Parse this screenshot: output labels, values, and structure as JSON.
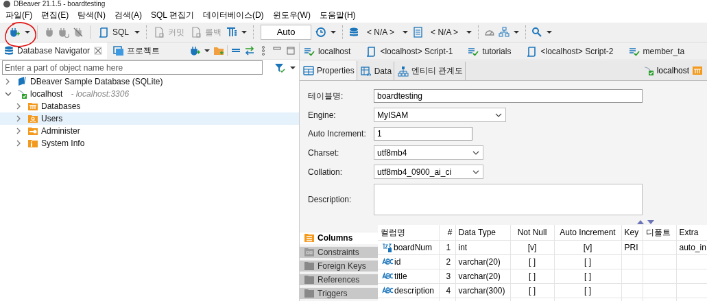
{
  "window": {
    "title": "DBeaver 21.1.5 - boardtesting"
  },
  "menu": [
    "파일(F)",
    "편집(E)",
    "탐색(N)",
    "검색(A)",
    "SQL 편집기",
    "데이터베이스(D)",
    "윈도우(W)",
    "도움말(H)"
  ],
  "toolbar": {
    "sql": "SQL",
    "commit": "커밋",
    "rollback": "롤백",
    "transaction_mode": "Auto",
    "datasource": "< N/A >",
    "schema": "< N/A >"
  },
  "navigator": {
    "tabs": [
      {
        "label": "Database Navigator",
        "selected": true
      },
      {
        "label": "프로젝트",
        "selected": false
      }
    ],
    "filter": {
      "placeholder": "Enter a part of object name here"
    },
    "tree": [
      {
        "label": "DBeaver Sample Database (SQLite)",
        "kind": "sqlite",
        "expanded": false,
        "selected": false
      },
      {
        "label": "localhost",
        "detail": "- localhost:3306",
        "kind": "mysql",
        "expanded": true,
        "selected": false,
        "children": [
          {
            "label": "Databases",
            "kind": "databases",
            "expanded": false,
            "selected": false
          },
          {
            "label": "Users",
            "kind": "users",
            "expanded": false,
            "selected": true
          },
          {
            "label": "Administer",
            "kind": "administer",
            "expanded": false,
            "selected": false
          },
          {
            "label": "System Info",
            "kind": "info",
            "expanded": false,
            "selected": false
          }
        ]
      }
    ]
  },
  "editor_tabs": [
    {
      "label": "localhost",
      "kind": "console",
      "selected": false
    },
    {
      "label": "<localhost> Script-1",
      "kind": "script",
      "selected": false
    },
    {
      "label": "tutorials",
      "kind": "console",
      "selected": false
    },
    {
      "label": "<localhost> Script-2",
      "kind": "script",
      "selected": false
    },
    {
      "label": "member_ta",
      "kind": "console",
      "selected": false
    }
  ],
  "sub_tabs": [
    {
      "label": "Properties",
      "kind": "properties",
      "selected": true
    },
    {
      "label": "Data",
      "kind": "data",
      "selected": false
    },
    {
      "label": "엔티티 관계도",
      "kind": "diagram",
      "selected": false
    }
  ],
  "connection": "localhost",
  "properties": [
    {
      "label": "테이블명:",
      "kind": "text",
      "value": "boardtesting"
    },
    {
      "label": "Engine:",
      "kind": "select",
      "value": "MyISAM"
    },
    {
      "label": "Auto Increment:",
      "kind": "short",
      "value": "1"
    },
    {
      "label": "Charset:",
      "kind": "select-small",
      "value": "utf8mb4"
    },
    {
      "label": "Collation:",
      "kind": "select-small",
      "value": "utf8mb4_0900_ai_ci"
    },
    {
      "label": "Description:",
      "kind": "textarea"
    }
  ],
  "side_tabs": [
    {
      "label": "Columns",
      "selected": true
    },
    {
      "label": "Constraints",
      "selected": false
    },
    {
      "label": "Foreign Keys",
      "selected": false
    },
    {
      "label": "References",
      "selected": false
    },
    {
      "label": "Triggers",
      "selected": false
    }
  ],
  "columns_table": {
    "columns": [
      "컬럼명",
      "#",
      "Data Type",
      "Not Null",
      "Auto Increment",
      "Key",
      "디폴트",
      "Extra"
    ],
    "rows": [
      {
        "kind": "number",
        "name": "boardNum",
        "index": "1",
        "data_type": "int",
        "not_null": "[v]",
        "auto_increment": "[v]",
        "key": "PRI",
        "extra": "auto_in"
      },
      {
        "kind": "string",
        "name": "id",
        "index": "2",
        "data_type": "varchar(20)",
        "not_null": "[ ]",
        "auto_increment": "[ ]"
      },
      {
        "kind": "string",
        "name": "title",
        "index": "3",
        "data_type": "varchar(20)",
        "not_null": "[ ]",
        "auto_increment": "[ ]"
      },
      {
        "kind": "string",
        "name": "description",
        "index": "4",
        "data_type": "varchar(300)",
        "not_null": "[ ]",
        "auto_increment": "[ ]"
      }
    ]
  }
}
